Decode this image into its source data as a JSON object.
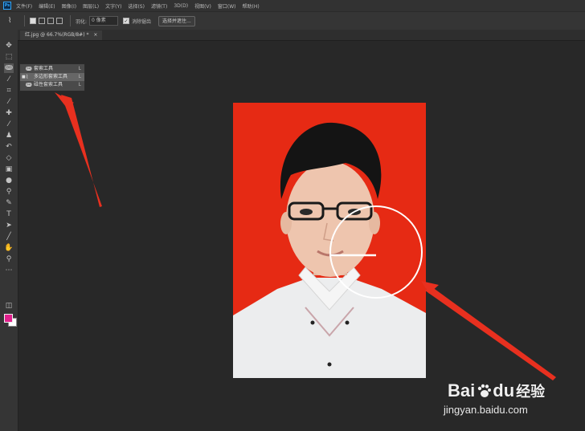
{
  "menubar": {
    "app_icon": "Ps",
    "items": [
      "文件(F)",
      "编辑(E)",
      "图像(I)",
      "图层(L)",
      "文字(Y)",
      "选择(S)",
      "滤镜(T)",
      "3D(D)",
      "视图(V)",
      "窗口(W)",
      "帮助(H)"
    ]
  },
  "options": {
    "feather_label": "羽化:",
    "feather_value": "0 像素",
    "antialias_label": "消除锯齿",
    "antialias_checked": true,
    "select_mask_button": "选择并遮住..."
  },
  "document": {
    "tab_label": "红.jpg @ 66.7%(RGB/8#) *",
    "close_glyph": "×"
  },
  "lasso_flyout": {
    "items": [
      {
        "marker": "",
        "icon": "lasso-icon",
        "label": "套索工具",
        "shortcut": "L"
      },
      {
        "marker": "■",
        "icon": "polygonal-lasso-icon",
        "label": "多边形套索工具",
        "shortcut": "L"
      },
      {
        "marker": "",
        "icon": "magnetic-lasso-icon",
        "label": "磁性套索工具",
        "shortcut": "L"
      }
    ]
  },
  "toolbar": {
    "tools": [
      "move-icon",
      "marquee-icon",
      "lasso-icon",
      "magic-wand-icon",
      "crop-icon",
      "eyedropper-icon",
      "healing-brush-icon",
      "brush-icon",
      "clone-stamp-icon",
      "history-brush-icon",
      "eraser-icon",
      "gradient-icon",
      "blur-icon",
      "dodge-icon",
      "pen-icon",
      "type-icon",
      "path-selection-icon",
      "line-icon",
      "hand-icon",
      "zoom-icon",
      "more-icon"
    ],
    "foreground_color": "#e0208c",
    "background_color": "#ffffff"
  },
  "watermark": {
    "brand": "Bai",
    "brand_suffix": "du",
    "service": "经验",
    "url": "jingyan.baidu.com"
  },
  "colors": {
    "photo_background": "#e62a14",
    "annotation_arrow": "#e8301f"
  }
}
